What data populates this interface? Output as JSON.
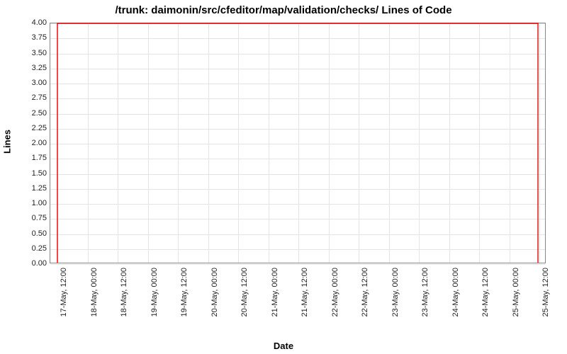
{
  "chart_data": {
    "type": "line",
    "title": "/trunk: daimonin/src/cfeditor/map/validation/checks/ Lines of Code",
    "xlabel": "Date",
    "ylabel": "Lines",
    "ylim": [
      0,
      4
    ],
    "y_ticks": [
      0.0,
      0.25,
      0.5,
      0.75,
      1.0,
      1.25,
      1.5,
      1.75,
      2.0,
      2.25,
      2.5,
      2.75,
      3.0,
      3.25,
      3.5,
      3.75,
      4.0
    ],
    "x_categories": [
      "17-May, 12:00",
      "18-May, 00:00",
      "18-May, 12:00",
      "19-May, 00:00",
      "19-May, 12:00",
      "20-May, 00:00",
      "20-May, 12:00",
      "21-May, 00:00",
      "21-May, 12:00",
      "22-May, 00:00",
      "22-May, 12:00",
      "23-May, 00:00",
      "23-May, 12:00",
      "24-May, 00:00",
      "24-May, 12:00",
      "25-May, 00:00",
      "25-May, 12:00"
    ],
    "series": [
      {
        "name": "Lines of Code",
        "color": "#ee0000",
        "x_index": [
          0,
          0,
          16,
          16
        ],
        "y": [
          0,
          4,
          4,
          0
        ]
      }
    ]
  }
}
